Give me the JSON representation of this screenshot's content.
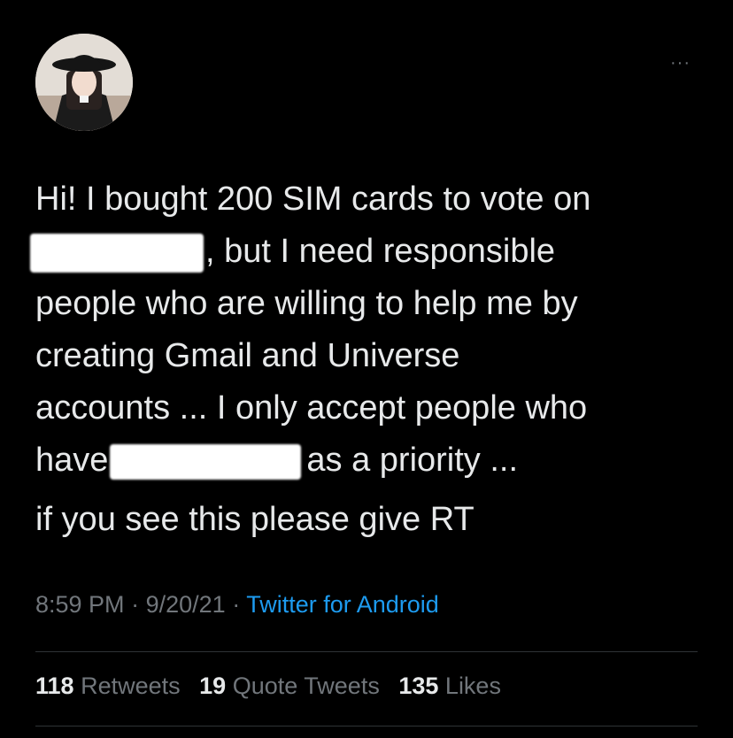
{
  "tweet": {
    "body_lines": {
      "l1": "Hi! I bought 200 SIM cards to vote on",
      "l2_after": ", but I need responsible",
      "l3": "people who are willing to help me by",
      "l4": "creating Gmail and Universe",
      "l5": "accounts ... I only accept people who",
      "l6_before": "have",
      "l6_after": "as a priority ...",
      "l7": "if you see this please give RT"
    },
    "time": "8:59 PM",
    "sep1": "·",
    "date": "9/20/21",
    "sep2": "·",
    "source": "Twitter for Android",
    "more_icon": "···"
  },
  "stats": {
    "retweets_count": "118",
    "retweets_label": "Retweets",
    "quote_count": "19",
    "quote_label": "Quote Tweets",
    "likes_count": "135",
    "likes_label": "Likes"
  },
  "colors": {
    "background": "#000000",
    "text": "#e7e9ea",
    "muted": "#71767b",
    "link": "#1d9bf0"
  }
}
